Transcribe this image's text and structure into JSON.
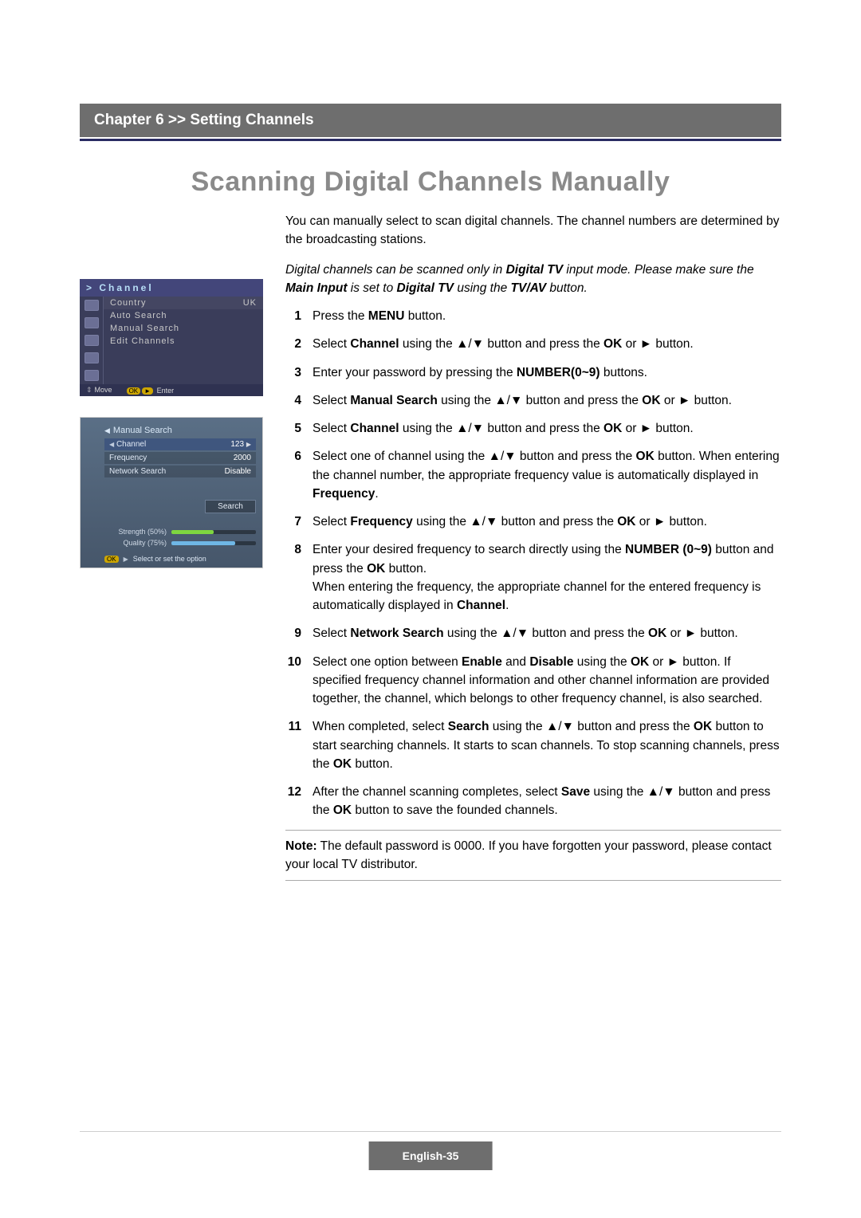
{
  "chapter_bar": "Chapter 6 >> Setting Channels",
  "title": "Scanning Digital Channels Manually",
  "intro1": "You can manually select to scan digital channels. The channel numbers are determined by the broadcasting stations.",
  "intro2_parts": {
    "a": "Digital channels can be scanned only in ",
    "b": "Digital TV",
    "c": " input mode. Please make sure the ",
    "d": "Main Input",
    "e": " is set to ",
    "f": "Digital TV",
    "g": " using the ",
    "h": "TV/AV",
    "i": " button."
  },
  "arrows": {
    "updown": "▲/▼",
    "right": "►"
  },
  "steps": {
    "s1": {
      "n": "1",
      "a": "Press the ",
      "b": "MENU",
      "c": " button."
    },
    "s2": {
      "n": "2",
      "a": "Select ",
      "b": "Channel",
      "c": " using the ",
      "d": " button and press the ",
      "e": "OK",
      "f": " or ",
      "g": " button."
    },
    "s3": {
      "n": "3",
      "a": "Enter your password by pressing the ",
      "b": "NUMBER(0~9)",
      "c": " buttons."
    },
    "s4": {
      "n": "4",
      "a": "Select ",
      "b": "Manual Search",
      "c": " using the ",
      "d": " button and press the ",
      "e": "OK",
      "f": " or ",
      "g": " button."
    },
    "s5": {
      "n": "5",
      "a": "Select ",
      "b": "Channel",
      "c": " using the ",
      "d": " button and press the ",
      "e": "OK",
      "f": " or ",
      "g": " button."
    },
    "s6": {
      "n": "6",
      "a": "Select one of channel using the ",
      "b": " button and press the ",
      "c": "OK",
      "d": " button. When entering the channel number, the appropriate frequency value is automatically displayed in ",
      "e": "Frequency",
      "f": "."
    },
    "s7": {
      "n": "7",
      "a": "Select ",
      "b": "Frequency",
      "c": " using the ",
      "d": " button and press the ",
      "e": "OK",
      "f": " or ",
      "g": " button."
    },
    "s8": {
      "n": "8",
      "a": "Enter your desired frequency to search directly using the ",
      "b": "NUMBER (0~9)",
      "c": " button and press the ",
      "d": "OK",
      "e": " button.",
      "l2a": "When entering the frequency, the appropriate channel for the entered frequency is automatically displayed in ",
      "l2b": "Channel",
      "l2c": "."
    },
    "s9": {
      "n": "9",
      "a": "Select ",
      "b": "Network Search",
      "c": " using the ",
      "d": " button and press the ",
      "e": "OK",
      "f": " or ",
      "g": " button."
    },
    "s10": {
      "n": "10",
      "a": "Select one option between ",
      "b": "Enable",
      "c": " and ",
      "d": "Disable",
      "e": " using the ",
      "f": "OK",
      "g": " or ",
      "h": " button. If specified frequency channel information and other channel information are provided together, the channel, which belongs to other frequency channel, is also searched."
    },
    "s11": {
      "n": "11",
      "a": "When completed, select ",
      "b": "Search",
      "c": " using the ",
      "d": " button and press the ",
      "e": "OK",
      "f": " button to start searching channels. It starts to scan channels. To stop scanning channels, press the ",
      "g": "OK",
      "h": " button."
    },
    "s12": {
      "n": "12",
      "a": "After the channel scanning completes, select ",
      "b": "Save",
      "c": " using the ",
      "d": " button and press the ",
      "e": "OK",
      "f": " button to save the founded channels."
    }
  },
  "note": {
    "label": "Note:",
    "text": " The default password is 0000. If you have forgotten your password, please contact your local TV distributor."
  },
  "page_number": "English-35",
  "menu": {
    "header": "> Channel",
    "items": [
      {
        "label": "Country",
        "value": "UK"
      },
      {
        "label": "Auto Search",
        "value": ""
      },
      {
        "label": "Manual Search",
        "value": ""
      },
      {
        "label": "Edit Channels",
        "value": ""
      }
    ],
    "footer": {
      "move": "Move",
      "enter": "Enter"
    }
  },
  "search": {
    "title": "Manual Search",
    "rows": [
      {
        "label": "Channel",
        "value": "123",
        "sel": true
      },
      {
        "label": "Frequency",
        "value": "2000"
      },
      {
        "label": "Network Search",
        "value": "Disable"
      }
    ],
    "button": "Search",
    "strength": {
      "label": "Strength (50%)"
    },
    "quality": {
      "label": "Quality (75%)"
    },
    "footer_hint": "Select or set the option"
  }
}
